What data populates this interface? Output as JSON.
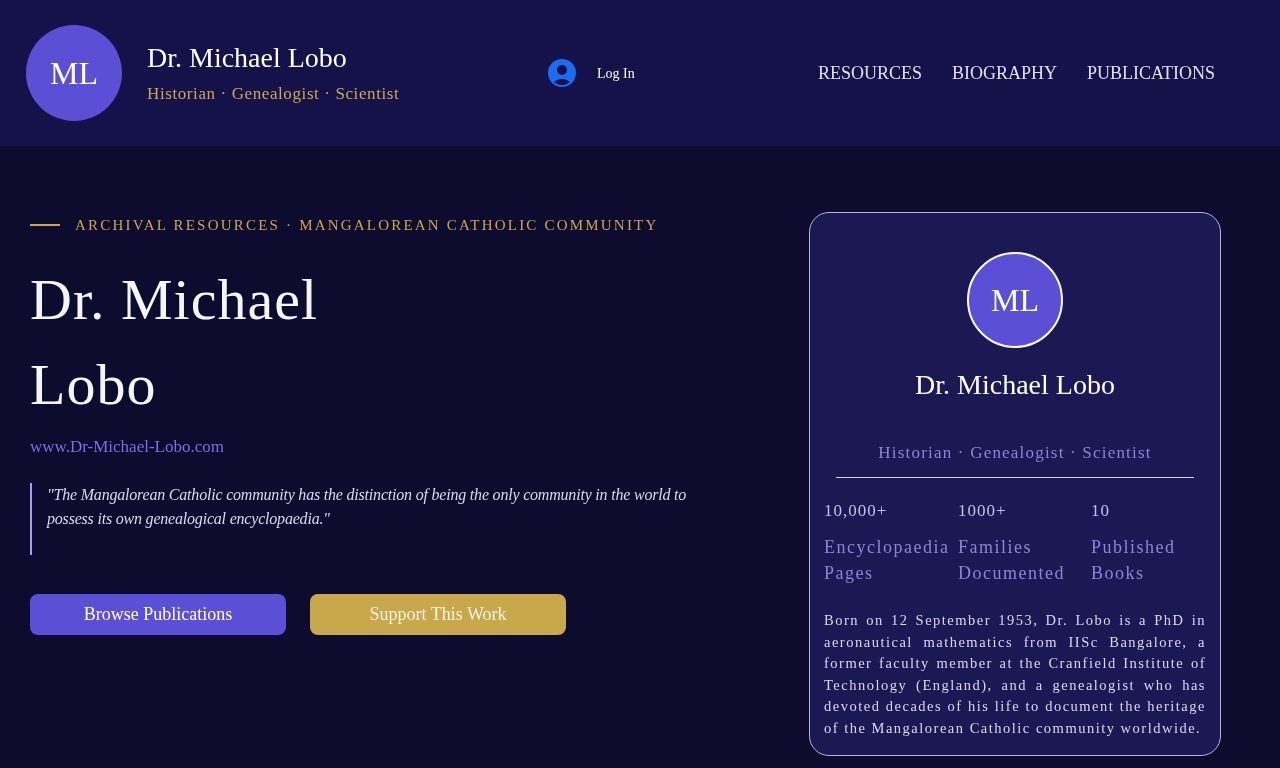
{
  "header": {
    "avatar_initials": "ML",
    "name": "Dr. Michael Lobo",
    "subtitle": "Historian · Genealogist · Scientist",
    "login": "Log In",
    "nav": [
      "RESOURCES",
      "BIOGRAPHY",
      "PUBLICATIONS"
    ]
  },
  "hero": {
    "eyebrow": "ARCHIVAL RESOURCES · MANGALOREAN CATHOLIC COMMUNITY",
    "title": "Dr. Michael Lobo",
    "website": "www.Dr-Michael-Lobo.com",
    "quote": "\"The Mangalorean Catholic community has the distinction of being the only community in the world to possess its own genealogical encyclopaedia.\"",
    "buttons": [
      {
        "label": "Browse Publications",
        "kind": "primary"
      },
      {
        "label": "Support This Work",
        "kind": "secondary"
      }
    ]
  },
  "profile_card": {
    "avatar_initials": "ML",
    "name": "Dr. Michael Lobo",
    "subtitle": "Historian · Genealogist · Scientist",
    "stats": [
      {
        "value": "10,000+",
        "label": "Encyclopaedia Pages"
      },
      {
        "value": "1000+",
        "label": "Families Documented"
      },
      {
        "value": "10",
        "label": "Published Books"
      }
    ],
    "bio": "Born on 12 September 1953, Dr. Lobo is a PhD in aeronautical mathematics from IISc Bangalore, a former faculty member at the Cranfield Institute of Technology (England), and a genealogist who has devoted decades of his life to document the heritage of the Mangalorean Catholic community worldwide."
  }
}
